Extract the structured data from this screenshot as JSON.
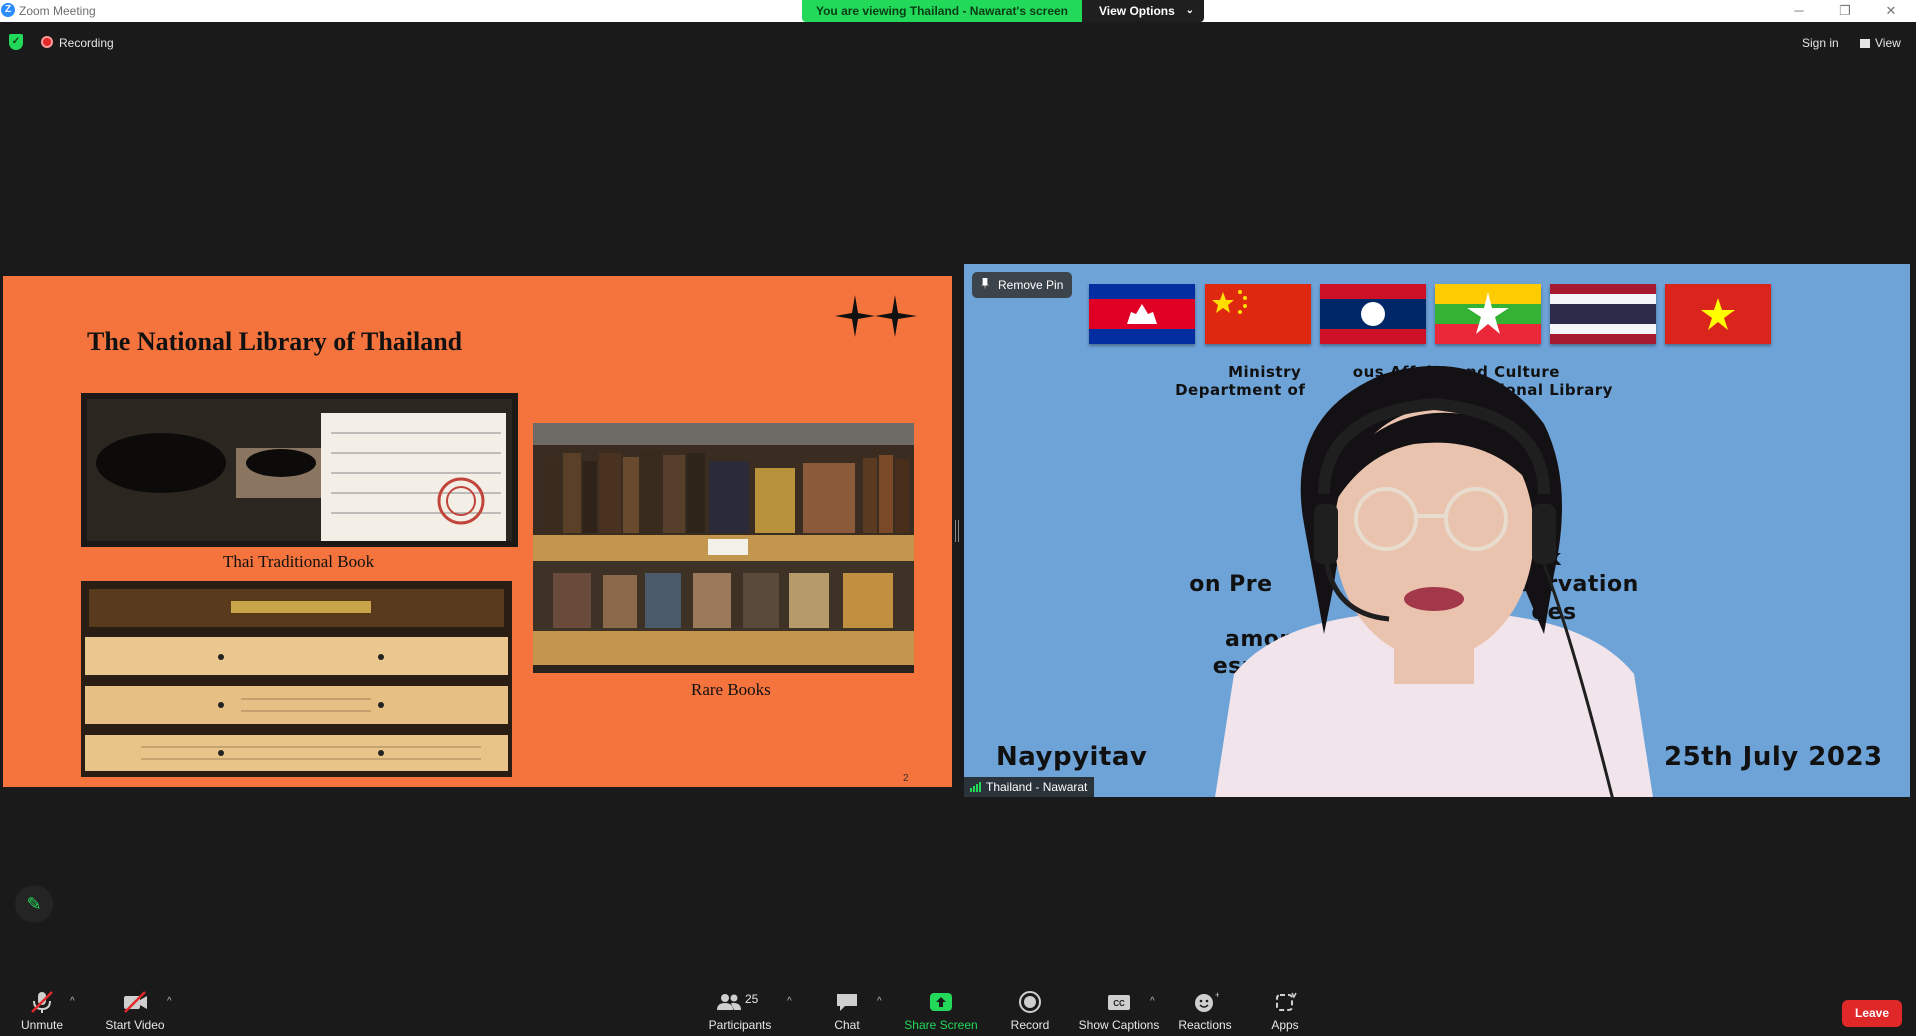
{
  "window": {
    "title": "Zoom Meeting",
    "minimize": "─",
    "restore": "❐",
    "close": "✕"
  },
  "banner": {
    "viewing_text": "You are viewing Thailand - Nawarat's screen",
    "view_options": "View Options"
  },
  "meeting_bar": {
    "recording": "Recording",
    "sign_in": "Sign in",
    "view": "View"
  },
  "slide": {
    "title": "The National Library of Thailand",
    "caption_traditional": "Thai Traditional Book",
    "caption_rare": "Rare Books",
    "page_number": "2"
  },
  "video": {
    "remove_pin": "Remove Pin",
    "participant_name": "Thailand - Nawarat",
    "flags": [
      "cambodia-flag",
      "china-flag",
      "laos-flag",
      "myanmar-flag",
      "thailand-flag",
      "vietnam-flag"
    ],
    "backdrop_lines": [
      "Ministry         ous Affairs and Culture",
      "Department of            earch and National Library",
      "k",
      "on Pre                              servation",
      "ges",
      "amor                    ng Area,",
      "especial                            ries",
      "Naypyitav",
      "25th July 2023"
    ]
  },
  "toolbar": {
    "unmute": "Unmute",
    "start_video": "Start Video",
    "participants": "Participants",
    "participant_count": "25",
    "chat": "Chat",
    "share_screen": "Share Screen",
    "record": "Record",
    "show_captions": "Show Captions",
    "reactions": "Reactions",
    "apps": "Apps",
    "leave": "Leave"
  },
  "colors": {
    "accent_green": "#23d959",
    "slide_bg": "#f5733d",
    "video_bg": "#6ea3d8",
    "leave_red": "#e02828"
  }
}
